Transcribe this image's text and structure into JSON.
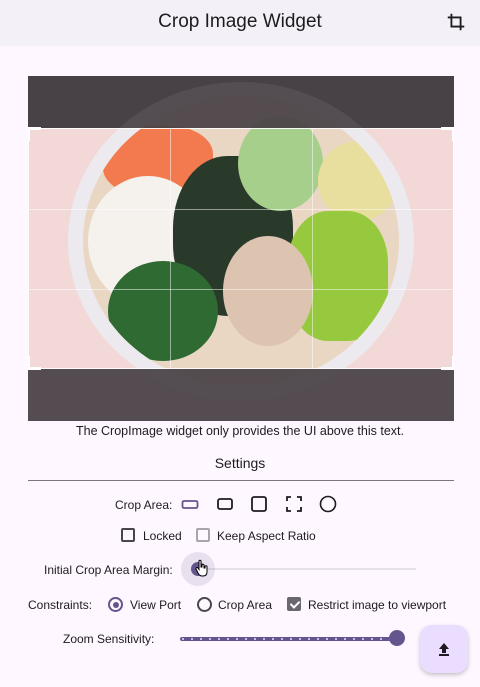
{
  "appbar": {
    "title": "Crop Image Widget",
    "action_icon": "crop-icon",
    "background": "#f4f0f7"
  },
  "crop_preview": {
    "image_subject": "poke bowl photo",
    "caption": "The CropImage widget only provides the UI above this text."
  },
  "settings": {
    "title": "Settings",
    "crop_area": {
      "label": "Crop Area:",
      "shapes": [
        {
          "name": "wide-rectangle",
          "selected": true
        },
        {
          "name": "rectangle",
          "selected": false
        },
        {
          "name": "square",
          "selected": false
        },
        {
          "name": "free-corners",
          "selected": false
        },
        {
          "name": "circle",
          "selected": false
        }
      ]
    },
    "locked": {
      "label": "Locked",
      "checked": false
    },
    "keep_aspect_ratio": {
      "label": "Keep Aspect Ratio",
      "checked": false,
      "enabled": false
    },
    "initial_margin": {
      "label": "Initial Crop Area Margin:",
      "value": 0.0
    },
    "constraints": {
      "label": "Constraints:",
      "options": [
        {
          "label": "View Port",
          "selected": true
        },
        {
          "label": "Crop Area",
          "selected": false
        }
      ],
      "restrict": {
        "label": "Restrict image to viewport",
        "checked": true
      }
    },
    "zoom_sensitivity": {
      "label": "Zoom Sensitivity:",
      "value": 1.0
    }
  },
  "fab": {
    "icon": "upload-icon"
  },
  "colors": {
    "accent": "#65558f",
    "fab": "#eaddff",
    "overlay": "#5f585c"
  }
}
